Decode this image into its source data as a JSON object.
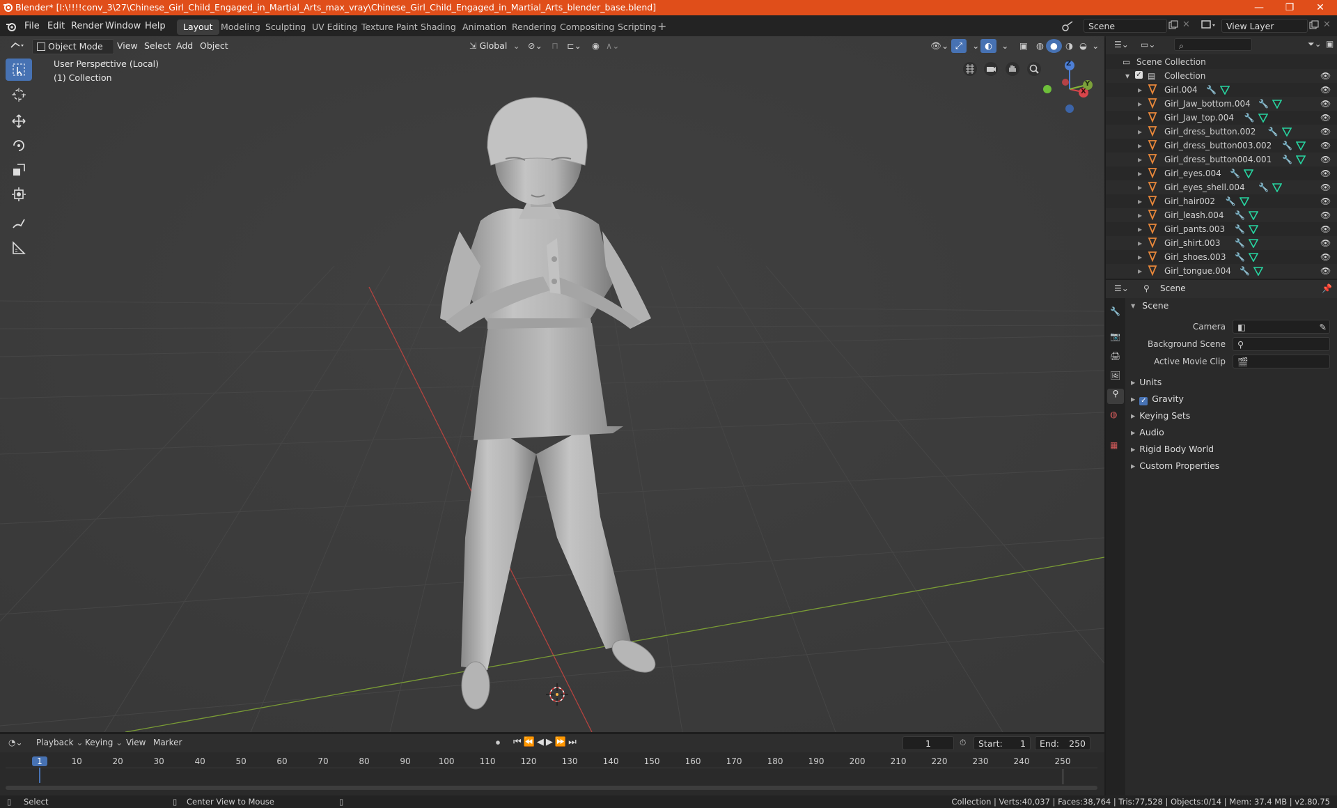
{
  "window": {
    "title": "Blender* [I:\\!!!!conv_3\\27\\Chinese_Girl_Child_Engaged_in_Martial_Arts_max_vray\\Chinese_Girl_Child_Engaged_in_Martial_Arts_blender_base.blend]",
    "minimize": "—",
    "maximize": "❐",
    "close": "✕"
  },
  "menu": [
    "File",
    "Edit",
    "Render",
    "Window",
    "Help"
  ],
  "workspaces": [
    "Layout",
    "Modeling",
    "Sculpting",
    "UV Editing",
    "Texture Paint",
    "Shading",
    "Animation",
    "Rendering",
    "Compositing",
    "Scripting"
  ],
  "active_workspace": "Layout",
  "scene_field": "Scene",
  "view_layer_field": "View Layer",
  "viewport": {
    "mode": "Object Mode",
    "menus": [
      "View",
      "Select",
      "Add",
      "Object"
    ],
    "orientation": "Global",
    "perspective_label": "User Perspective (Local)",
    "collection_label": "(1) Collection",
    "gizmo": {
      "x": "X",
      "y": "Y",
      "z": "Z"
    }
  },
  "outliner": {
    "root": "Scene Collection",
    "collection": "Collection",
    "items": [
      "Girl.004",
      "Girl_Jaw_bottom.004",
      "Girl_Jaw_top.004",
      "Girl_dress_button.002",
      "Girl_dress_button003.002",
      "Girl_dress_button004.001",
      "Girl_eyes.004",
      "Girl_eyes_shell.004",
      "Girl_hair002",
      "Girl_leash.004",
      "Girl_pants.003",
      "Girl_shirt.003",
      "Girl_shoes.003",
      "Girl_tongue.004"
    ]
  },
  "properties": {
    "header": "Scene",
    "section": "Scene",
    "camera_label": "Camera",
    "background_scene_label": "Background Scene",
    "active_movie_clip_label": "Active Movie Clip",
    "panels": [
      "Units",
      "Gravity",
      "Keying Sets",
      "Audio",
      "Rigid Body World",
      "Custom Properties"
    ]
  },
  "timeline": {
    "menus": [
      "Playback",
      "Keying",
      "View",
      "Marker"
    ],
    "current_frame": "1",
    "start_label": "Start:",
    "start": "1",
    "end_label": "End:",
    "end": "250",
    "ticks": [
      "1",
      "10",
      "20",
      "30",
      "40",
      "50",
      "60",
      "70",
      "80",
      "90",
      "100",
      "110",
      "120",
      "130",
      "140",
      "150",
      "160",
      "170",
      "180",
      "190",
      "200",
      "210",
      "220",
      "230",
      "240",
      "250"
    ]
  },
  "statusbar": {
    "left": "Select",
    "middle": "Center View to Mouse",
    "right": "Collection | Verts:40,037 | Faces:38,764 | Tris:77,528 | Objects:0/14 | Mem: 37.4 MB | v2.80.75"
  },
  "colors": {
    "accent": "#4772b3",
    "titlebar": "#e04e1a",
    "mesh_icon": "#e8873a",
    "modifier_icon": "#6f9bd8",
    "data_icon": "#27d4a0"
  }
}
